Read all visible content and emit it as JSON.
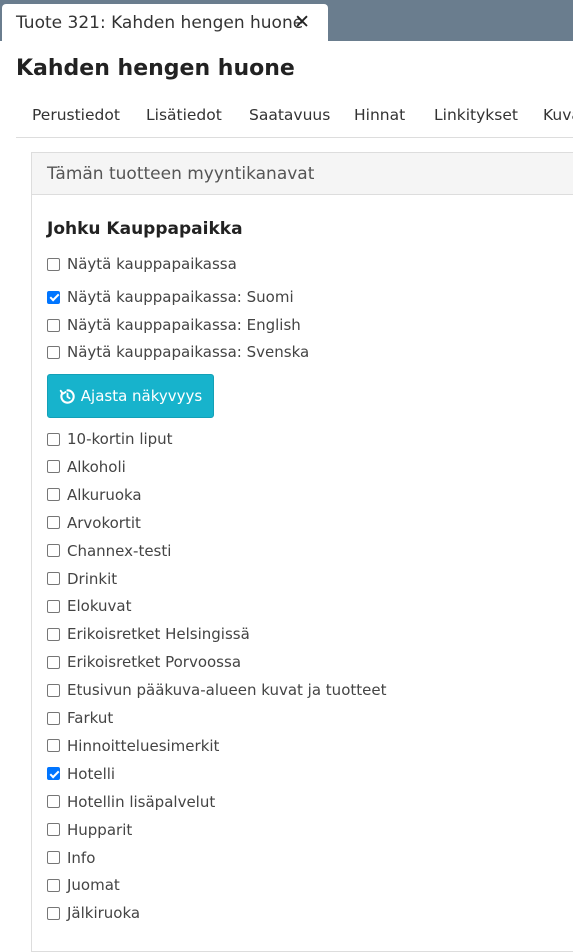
{
  "window_tab": {
    "title": "Tuote 321: Kahden hengen huone",
    "close_glyph": "✕"
  },
  "page_title": "Kahden hengen huone",
  "nav_tabs": [
    "Perustiedot",
    "Lisätiedot",
    "Saatavuus",
    "Hinnat",
    "Linkitykset",
    "Kuva"
  ],
  "panel": {
    "heading": "Tämän tuotteen myyntikanavat",
    "section_title": "Johku Kauppapaikka",
    "marketplace_options": [
      {
        "label": "Näytä kauppapaikassa",
        "checked": false
      },
      {
        "label": "Näytä kauppapaikassa: Suomi",
        "checked": true
      },
      {
        "label": "Näytä kauppapaikassa: English",
        "checked": false
      },
      {
        "label": "Näytä kauppapaikassa: Svenska",
        "checked": false
      }
    ],
    "schedule_button": {
      "label": "Ajasta näkyvyys",
      "icon": "clock-refresh-icon"
    },
    "categories": [
      {
        "label": "10-kortin liput",
        "checked": false
      },
      {
        "label": "Alkoholi",
        "checked": false
      },
      {
        "label": "Alkuruoka",
        "checked": false
      },
      {
        "label": "Arvokortit",
        "checked": false
      },
      {
        "label": "Channex-testi",
        "checked": false
      },
      {
        "label": "Drinkit",
        "checked": false
      },
      {
        "label": "Elokuvat",
        "checked": false
      },
      {
        "label": "Erikoisretket Helsingissä",
        "checked": false
      },
      {
        "label": "Erikoisretket Porvoossa",
        "checked": false
      },
      {
        "label": "Etusivun pääkuva-alueen kuvat ja tuotteet",
        "checked": false
      },
      {
        "label": "Farkut",
        "checked": false
      },
      {
        "label": "Hinnoitteluesimerkit",
        "checked": false
      },
      {
        "label": "Hotelli",
        "checked": true
      },
      {
        "label": "Hotellin lisäpalvelut",
        "checked": false
      },
      {
        "label": "Hupparit",
        "checked": false
      },
      {
        "label": "Info",
        "checked": false
      },
      {
        "label": "Juomat",
        "checked": false
      },
      {
        "label": "Jälkiruoka",
        "checked": false
      }
    ]
  },
  "colors": {
    "topbar": "#6a7d8e",
    "button": "#17b3cc",
    "checkbox_checked": "#0075ff"
  }
}
